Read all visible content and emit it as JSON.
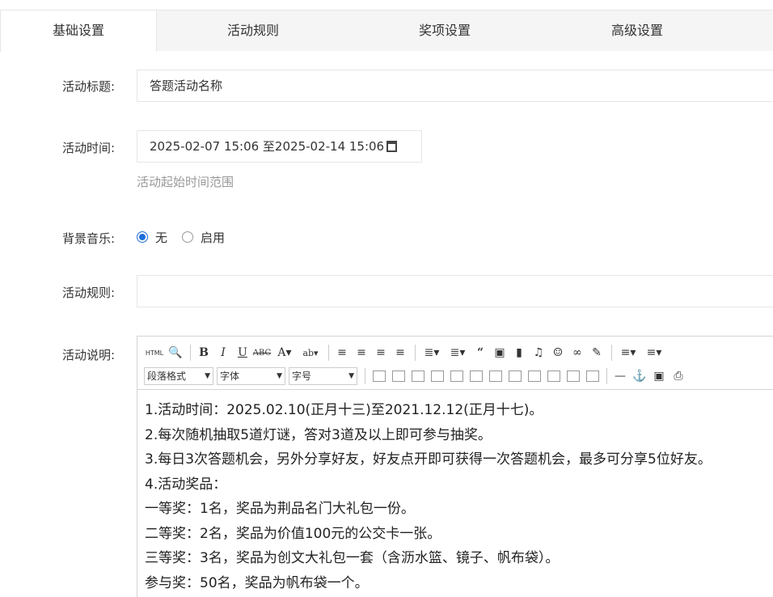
{
  "tabs": [
    {
      "label": "基础设置",
      "active": true
    },
    {
      "label": "活动规则",
      "active": false
    },
    {
      "label": "奖项设置",
      "active": false
    },
    {
      "label": "高级设置",
      "active": false
    }
  ],
  "form": {
    "title": {
      "label": "活动标题:",
      "value": "答题活动名称"
    },
    "time": {
      "label": "活动时间:",
      "value": "2025-02-07 15:06 至2025-02-14 15:06",
      "hint": "活动起始时间范围"
    },
    "music": {
      "label": "背景音乐:",
      "options": [
        "无",
        "启用"
      ],
      "selected": "无"
    },
    "rules": {
      "label": "活动规则:",
      "value": ""
    },
    "desc": {
      "label": "活动说明:"
    }
  },
  "editor": {
    "toolbar": {
      "html_label": "HTML",
      "paragraph": "段落格式",
      "font": "字体",
      "size": "字号"
    },
    "lines": [
      "1.活动时间：2025.02.10(正月十三)至2021.12.12(正月十七)。",
      "2.每次随机抽取5道灯谜，答对3道及以上即可参与抽奖。",
      "3.每日3次答题机会，另外分享好友，好友点开即可获得一次答题机会，最多可分享5位好友。",
      "4.活动奖品：",
      "一等奖：1名，奖品为荆品名门大礼包一份。",
      "二等奖：2名，奖品为价值100元的公交卡一张。",
      "三等奖：3名，奖品为创文大礼包一套（含沥水篮、镜子、帆布袋）。",
      "参与奖：50名，奖品为帆布袋一个。"
    ]
  }
}
